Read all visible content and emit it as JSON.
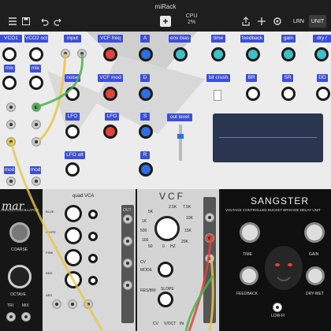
{
  "app": {
    "title": "miRack"
  },
  "toolbar": {
    "add": "+",
    "cpu_label": "CPU",
    "cpu_value": "2%",
    "learn": "LRN",
    "unit": "UNIT"
  },
  "labels": {
    "vco1_oct": "VCO1 oct",
    "vco2_oct": "VCO2 oct",
    "input": "input",
    "vcf_freq": "VCF freq",
    "a": "A",
    "env_bias": "env bias",
    "time": "time",
    "feedback": "feedback",
    "gain": "gain",
    "dry_wet": "dry / wet",
    "mix1": "mix",
    "mix2": "mix",
    "noise": "noise",
    "vcf_mod": "VCF mod",
    "d": "D",
    "bit_crush": "bit crush",
    "br": "BR",
    "sr": "SR",
    "dd": "DD",
    "lfo1": "LFO",
    "lfo2": "LFO",
    "s": "S",
    "out_level": "out level",
    "lfo_att": "LFO att",
    "r": "R",
    "mod1": "mod",
    "mod2": "mod"
  },
  "modules": {
    "osc_name": "mar",
    "osc_sub": "ANALOG OSCILLATOR",
    "coarse": "COARSE",
    "octave": "OCTAVE",
    "tri": "TRI",
    "mix": "MIX",
    "vca_title": "quad VCA",
    "blue": "BLUE",
    "white": "WHITE",
    "pink": "PINK",
    "red": "RED",
    "exp": "EXP",
    "lin": "LIN",
    "abs": "ABS",
    "in": "IN",
    "out": "OUT",
    "vcf_title": "VCF",
    "vcf_scale": [
      "2.5K",
      "5K",
      "7.5K",
      "1K",
      "10K",
      "500",
      "15K",
      "100",
      "20K",
      "50",
      "0",
      "HZ"
    ],
    "cv": "CV",
    "mode": "MODE",
    "slope": "SLOPE",
    "res_bw": "RES/BW",
    "v_oct": "V/OCT",
    "cv2": "CV",
    "sangster_title": "SANGSTER",
    "sangster_sub": "VOLTAGE CONTROLLED BUCKET BRIGADE DELAY UNIT",
    "s_time": "TIME",
    "s_gain": "GAIN",
    "s_feedback": "FEEDBACK",
    "s_drywet": "DRY-WET",
    "lowfi": "LOW-FI"
  },
  "colors": {
    "label_bg": "#3b4fd8",
    "knob_white": "#ffffff",
    "knob_red": "#e0453a",
    "knob_blue": "#2d6fe0",
    "knob_teal": "#3ec0c8"
  }
}
